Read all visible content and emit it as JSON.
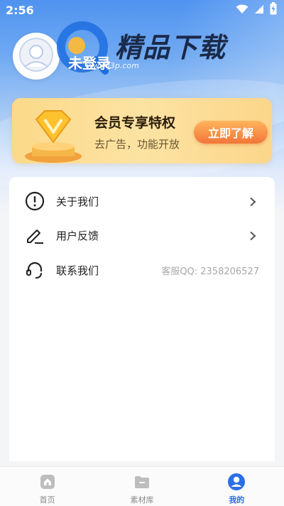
{
  "status_bar": {
    "time": "2:56",
    "icons": [
      "wifi-icon",
      "signal-icon",
      "battery-charging-icon"
    ]
  },
  "profile": {
    "login_label": "未登录",
    "avatar_icon": "user-avatar-icon"
  },
  "watermark": {
    "brand": "精品下载",
    "url": "www.j3p.com"
  },
  "vip_card": {
    "title": "会员专享特权",
    "subtitle": "去广告，功能开放",
    "button_label": "立即了解",
    "badge_icon": "diamond-trophy-icon",
    "colors": {
      "card": "#fbd98a",
      "button": "#f2753a"
    }
  },
  "menu": {
    "items": [
      {
        "label": "关于我们",
        "icon": "info-circle-icon",
        "has_arrow": true,
        "extra": ""
      },
      {
        "label": "用户反馈",
        "icon": "pen-edit-icon",
        "has_arrow": true,
        "extra": ""
      },
      {
        "label": "联系我们",
        "icon": "headset-icon",
        "has_arrow": false,
        "extra": "客服QQ: 2358206527"
      }
    ]
  },
  "bottom_nav": {
    "items": [
      {
        "label": "首页",
        "icon": "home-icon",
        "active": false
      },
      {
        "label": "素材库",
        "icon": "folder-icon",
        "active": false
      },
      {
        "label": "我的",
        "icon": "user-profile-icon",
        "active": true
      }
    ],
    "colors": {
      "active": "#2a6fe8",
      "inactive": "#888888"
    }
  }
}
